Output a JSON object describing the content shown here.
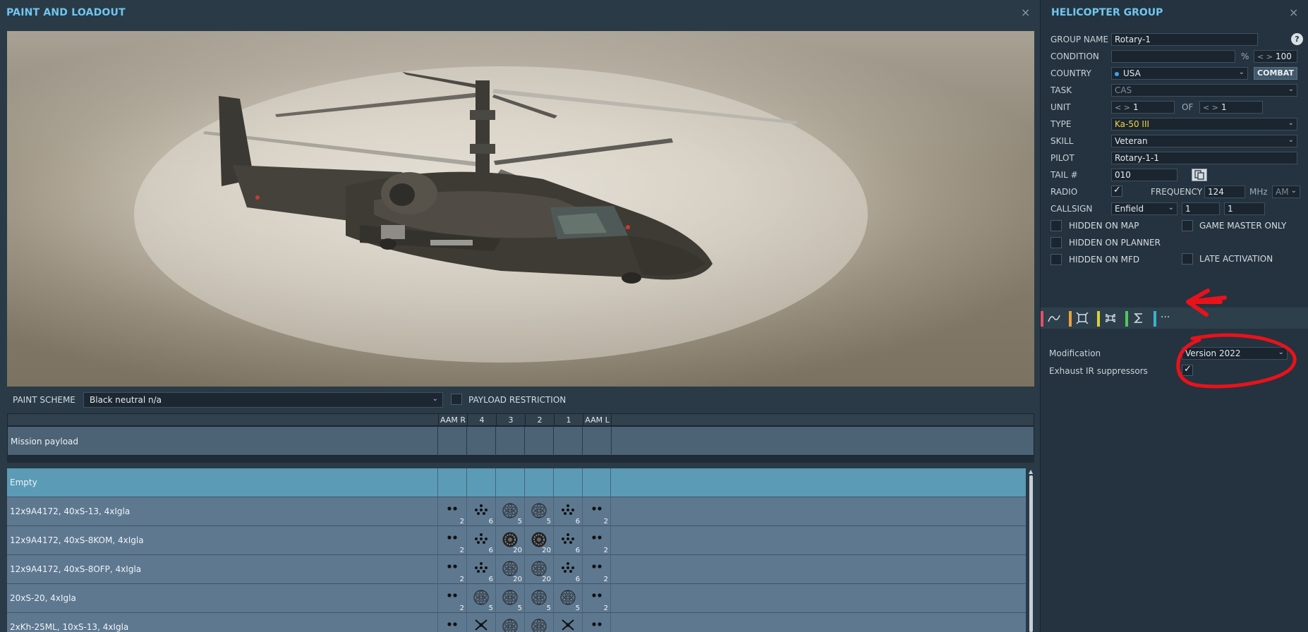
{
  "left_panel": {
    "title": "PAINT AND LOADOUT",
    "close_glyph": "×",
    "paint_scheme_label": "PAINT SCHEME",
    "paint_scheme_value": "Black neutral n/a",
    "payload_restriction_label": "PAYLOAD RESTRICTION",
    "table": {
      "columns": [
        "AAM R",
        "4",
        "3",
        "2",
        "1",
        "AAM L"
      ],
      "mission_payload_label": "Mission payload",
      "rows": [
        {
          "name": "Empty",
          "selected": true,
          "cells": [
            "",
            "",
            "",
            "",
            "",
            ""
          ]
        },
        {
          "name": "12x9A4172, 40xS-13, 4xIgla",
          "cells": [
            "2",
            "6",
            "5",
            "5",
            "6",
            "2"
          ]
        },
        {
          "name": "12x9A4172, 40xS-8KOM, 4xIgla",
          "cells": [
            "2",
            "6",
            "20",
            "20",
            "6",
            "2"
          ]
        },
        {
          "name": "12x9A4172, 40xS-8OFP, 4xIgla",
          "cells": [
            "2",
            "6",
            "20",
            "20",
            "6",
            "2"
          ]
        },
        {
          "name": "20xS-20, 4xIgla",
          "cells": [
            "2",
            "5",
            "5",
            "5",
            "5",
            "2"
          ]
        },
        {
          "name": "2xKh-25ML, 10xS-13, 4xIgla",
          "cells": [
            "",
            "",
            "",
            "",
            "",
            ""
          ]
        }
      ],
      "cell_icons": [
        [
          "",
          "",
          "",
          "",
          "",
          ""
        ],
        [
          "pair",
          "cluster",
          "rocketpod",
          "rocketpod",
          "cluster",
          "pair"
        ],
        [
          "pair",
          "cluster",
          "rocketpod-dark",
          "rocketpod-dark",
          "cluster",
          "pair"
        ],
        [
          "pair",
          "cluster",
          "rocketpod",
          "rocketpod",
          "cluster",
          "pair"
        ],
        [
          "pair",
          "rocketpod",
          "rocketpod",
          "rocketpod",
          "rocketpod",
          "pair"
        ],
        [
          "pair",
          "missile",
          "rocketpod",
          "rocketpod",
          "missile",
          "pair"
        ]
      ]
    }
  },
  "right_panel": {
    "title": "HELICOPTER GROUP",
    "close_glyph": "×",
    "group_name_label": "GROUP NAME",
    "group_name_value": "Rotary-1",
    "help_glyph": "?",
    "condition_label": "CONDITION",
    "condition_value": "",
    "condition_unit": "%",
    "condition_pct": "100",
    "country_label": "COUNTRY",
    "country_value": "USA",
    "combat_label": "COMBAT",
    "task_label": "TASK",
    "task_value": "CAS",
    "unit_label": "UNIT",
    "unit_value": "1",
    "of_label": "OF",
    "of_value": "1",
    "type_label": "TYPE",
    "type_value": "Ka-50 III",
    "skill_label": "SKILL",
    "skill_value": "Veteran",
    "pilot_label": "PILOT",
    "pilot_value": "Rotary-1-1",
    "tail_label": "TAIL #",
    "tail_value": "010",
    "radio_label": "RADIO",
    "frequency_label": "FREQUENCY",
    "frequency_value": "124",
    "mhz_label": "MHz",
    "modulation_value": "AM",
    "callsign_label": "CALLSIGN",
    "callsign_value": "Enfield",
    "callsign_num1": "1",
    "callsign_num2": "1",
    "checks": {
      "hidden_on_map": "HIDDEN ON MAP",
      "game_master_only": "GAME MASTER ONLY",
      "hidden_on_planner": "HIDDEN ON PLANNER",
      "hidden_on_mfd": "HIDDEN ON MFD",
      "late_activation": "LATE ACTIVATION"
    },
    "tabs": [
      {
        "icon": "route-icon",
        "color": "#e0506a"
      },
      {
        "icon": "target-icon",
        "color": "#e8a13a"
      },
      {
        "icon": "command-icon",
        "color": "#d9d13a"
      },
      {
        "icon": "sum-icon",
        "color": "#4fc85a"
      },
      {
        "icon": "more-icon",
        "color": "#3ab2c9"
      }
    ],
    "more_glyph": "···",
    "modification_label": "Modification",
    "modification_value": "Version 2022",
    "exhaust_label": "Exhaust IR suppressors"
  },
  "annotation_color": "#e8121b"
}
